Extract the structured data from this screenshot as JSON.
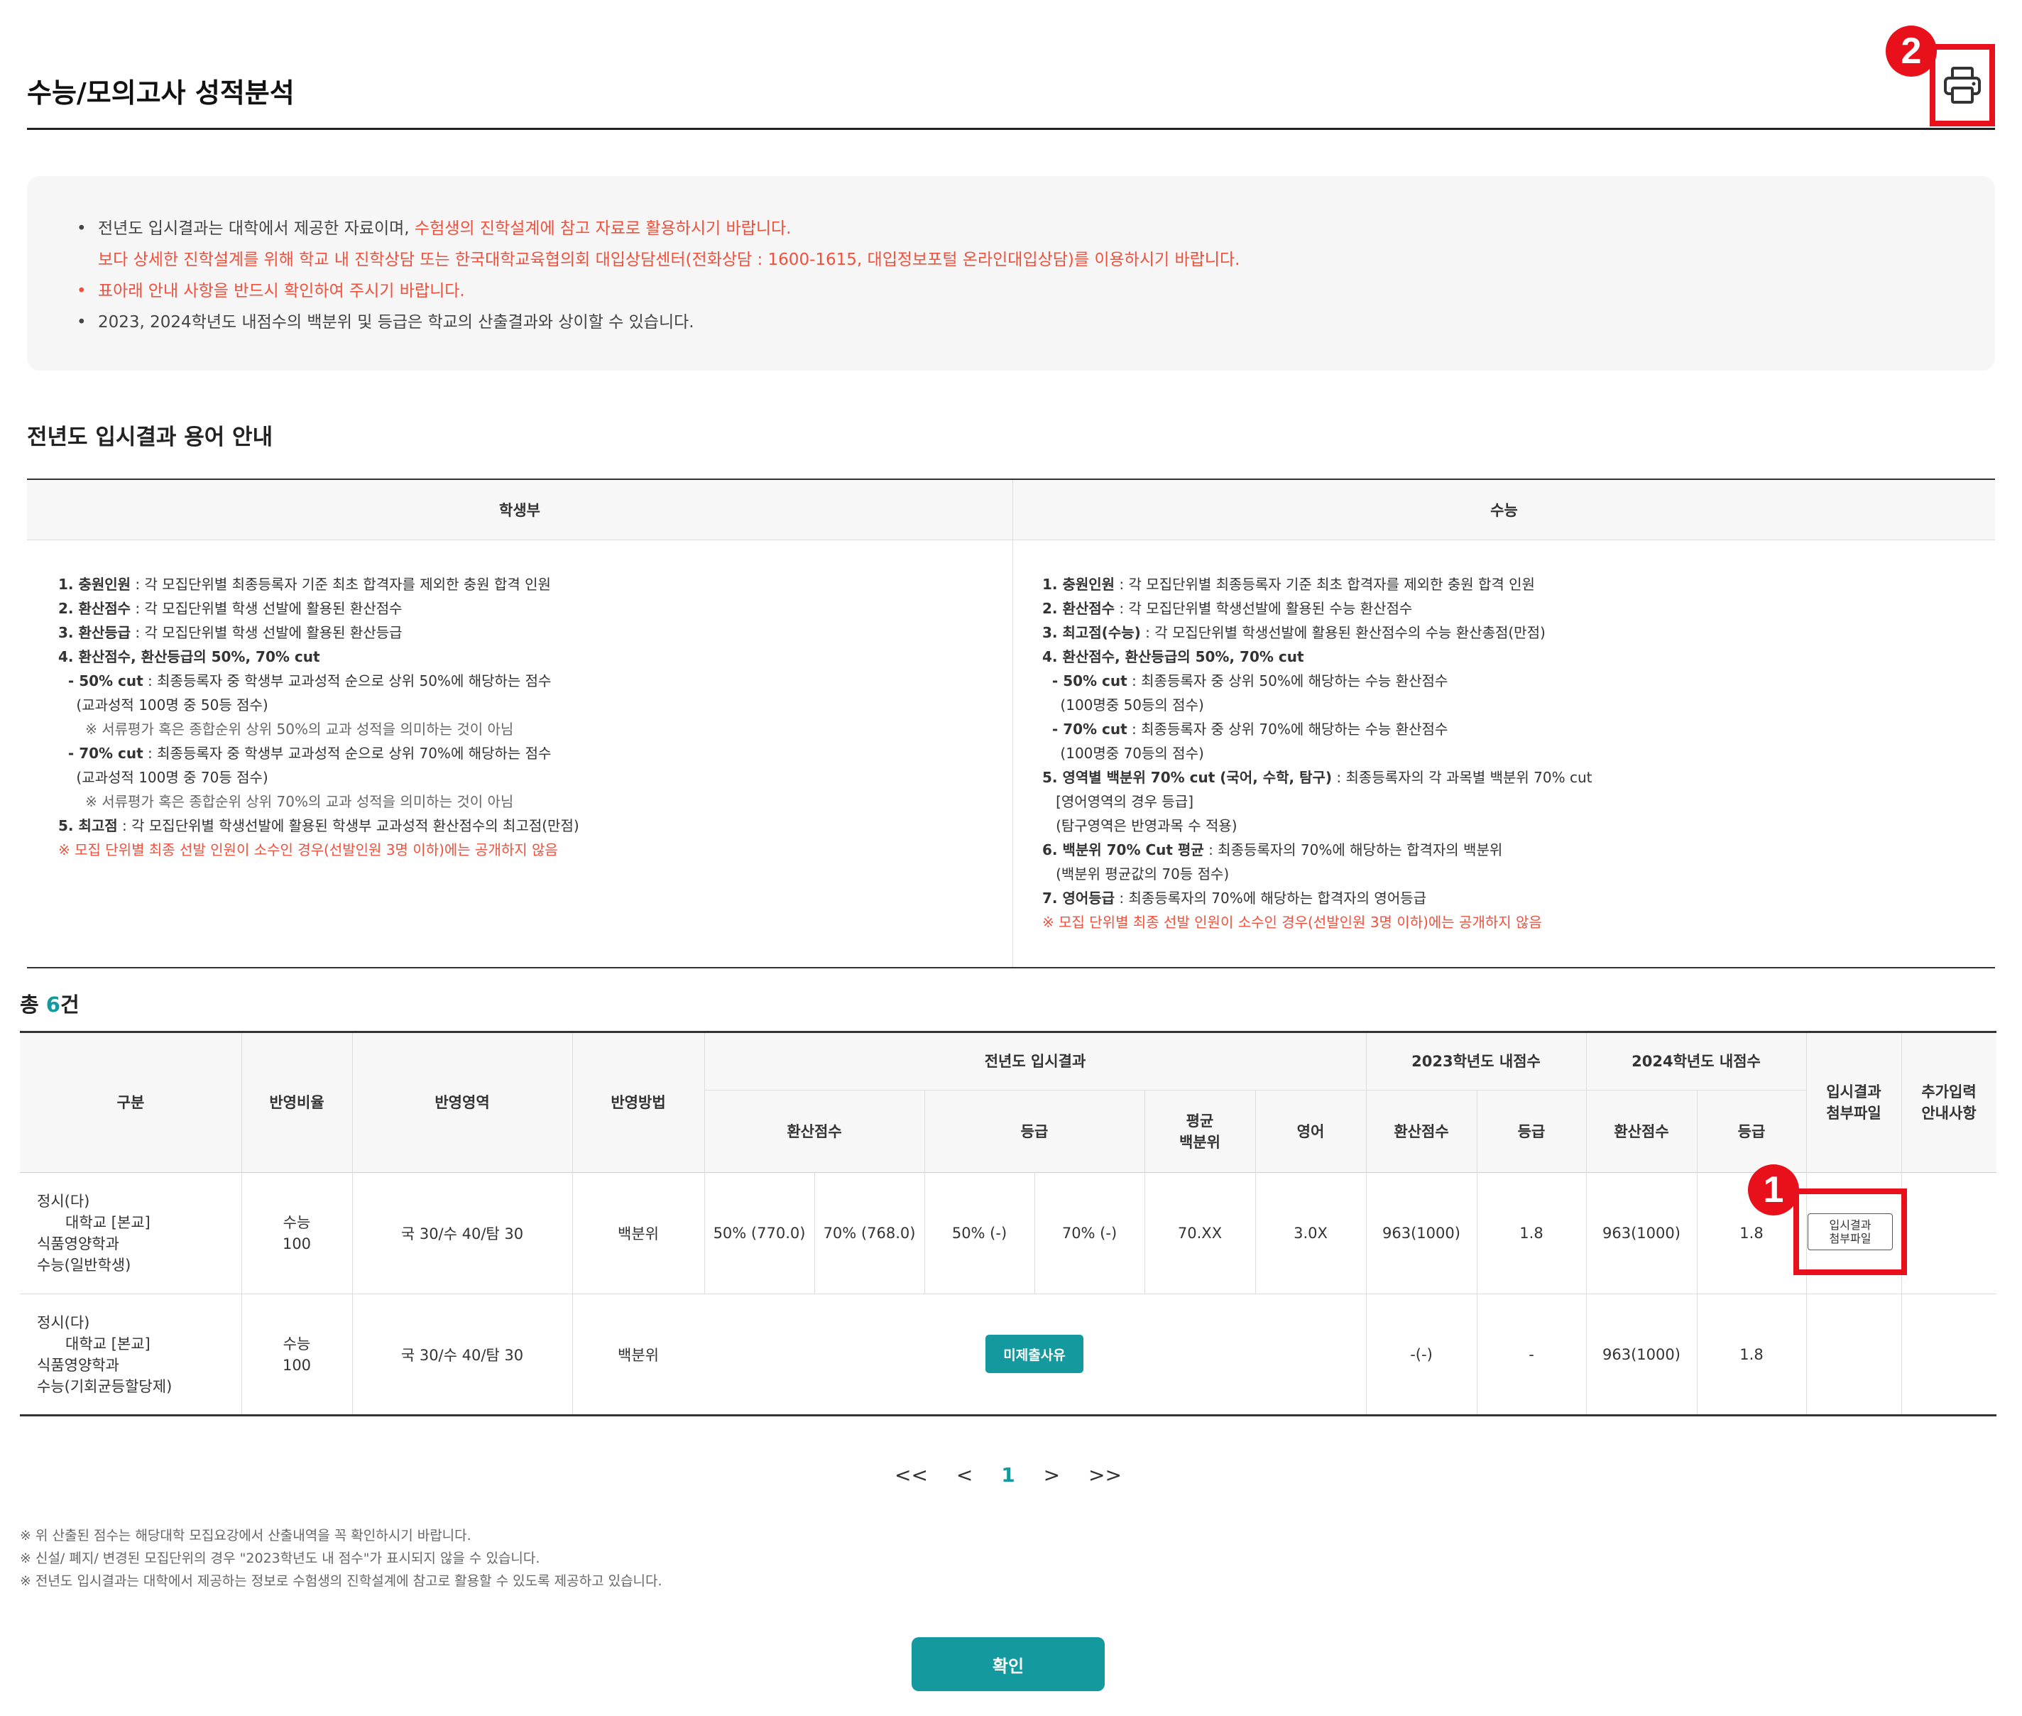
{
  "header": {
    "title": "수능/모의고사 성적분석",
    "print_icon": "printer-icon",
    "callout_2": "2"
  },
  "notice": {
    "line1_a": "전년도 입시결과는 대학에서 제공한 자료이며, ",
    "line1_b": "수험생의 진학설계에 참고 자료로 활용하시기 바랍니다.",
    "line2": "보다 상세한 진학설계를 위해 학교 내 진학상담 또는 한국대학교육협의회 대입상담센터(전화상담 : 1600-1615, 대입정보포털 온라인대입상담)를 이용하시기 바랍니다.",
    "line3": "표아래 안내 사항을 반드시 확인하여 주시기 바랍니다.",
    "line4": "2023, 2024학년도 내점수의 백분위 및 등급은 학교의 산출결과와 상이할 수 있습니다."
  },
  "terms": {
    "heading": "전년도 입시결과 용어 안내",
    "col_student": "학생부",
    "col_suneung": "수능",
    "student_lines": [
      {
        "b": "1. 충원인원",
        "t": " : 각 모집단위별 최종등록자 기준 최초 합격자를 제외한 충원 합격 인원"
      },
      {
        "b": "2. 환산점수",
        "t": " : 각 모집단위별 학생 선발에 활용된 환산점수"
      },
      {
        "b": "3. 환산등급",
        "t": " : 각 모집단위별 학생 선발에 활용된 환산등급"
      },
      {
        "b": "4. 환산점수, 환산등급의 50%, 70% cut",
        "t": ""
      },
      {
        "b": "  - 50% cut",
        "t": " : 최종등록자 중 학생부 교과성적 순으로 상위 50%에 해당하는 점수"
      },
      {
        "b": "",
        "t": "    (교과성적 100명 중 50등 점수)"
      },
      {
        "b": "",
        "t": "      ※ 서류평가 혹은 종합순위 상위 50%의 교과 성적을 의미하는 것이 아님",
        "cls": "note"
      },
      {
        "b": "  - 70% cut",
        "t": " : 최종등록자 중 학생부 교과성적 순으로 상위 70%에 해당하는 점수"
      },
      {
        "b": "",
        "t": "    (교과성적 100명 중 70등 점수)"
      },
      {
        "b": "",
        "t": "      ※ 서류평가 혹은 종합순위 상위 70%의 교과 성적을 의미하는 것이 아님",
        "cls": "note"
      },
      {
        "b": "5. 최고점",
        "t": " : 각 모집단위별 학생선발에 활용된 학생부 교과성적 환산점수의 최고점(만점)"
      },
      {
        "b": "",
        "t": "※ 모집 단위별 최종 선발 인원이 소수인 경우(선발인원 3명 이하)에는 공개하지 않음",
        "cls": "warn"
      }
    ],
    "suneung_lines": [
      {
        "b": "1. 충원인원",
        "t": " : 각 모집단위별 최종등록자 기준 최초 합격자를 제외한 충원 합격 인원"
      },
      {
        "b": "2. 환산점수",
        "t": " : 각 모집단위별 학생선발에 활용된 수능 환산점수"
      },
      {
        "b": "3. 최고점(수능)",
        "t": " : 각 모집단위별 학생선발에 활용된 환산점수의 수능 환산총점(만점)"
      },
      {
        "b": "4. 환산점수, 환산등급의 50%, 70% cut",
        "t": ""
      },
      {
        "b": "  - 50% cut",
        "t": " : 최종등록자 중 상위 50%에 해당하는 수능 환산점수"
      },
      {
        "b": "",
        "t": "    (100명중 50등의 점수)"
      },
      {
        "b": "  - 70% cut",
        "t": " : 최종등록자 중 상위 70%에 해당하는 수능 환산점수"
      },
      {
        "b": "",
        "t": "    (100명중 70등의 점수)"
      },
      {
        "b": "5. 영역별 백분위 70% cut (국어, 수학, 탐구)",
        "t": " : 최종등록자의 각 과목별 백분위 70% cut"
      },
      {
        "b": "",
        "t": "   [영어영역의 경우 등급]"
      },
      {
        "b": "",
        "t": "   (탐구영역은 반영과목 수 적용)"
      },
      {
        "b": "6. 백분위 70% Cut 평균",
        "t": " : 최종등록자의 70%에 해당하는 합격자의 백분위"
      },
      {
        "b": "",
        "t": "   (백분위 평균값의 70등 점수)"
      },
      {
        "b": "7. 영어등급",
        "t": " : 최종등록자의 70%에 해당하는 합격자의 영어등급"
      },
      {
        "b": "",
        "t": "※ 모집 단위별 최종 선발 인원이 소수인 경우(선발인원 3명 이하)에는 공개하지 않음",
        "cls": "warn"
      }
    ]
  },
  "total": {
    "prefix": "총 ",
    "count": "6",
    "suffix": "건"
  },
  "table": {
    "h_category": "구분",
    "h_ratio": "반영비율",
    "h_area": "반영영역",
    "h_method": "반영방법",
    "h_prev": "전년도 입시결과",
    "h_2023": "2023학년도 내점수",
    "h_2024": "2024학년도 내점수",
    "h_attach": "입시결과\n첨부파일",
    "h_extra": "추가입력\n안내사항",
    "h_score": "환산점수",
    "h_grade": "등급",
    "h_avg": "평균\n백분위",
    "h_eng": "영어",
    "h_2023_score": "환산점수",
    "h_2023_grade": "등급",
    "h_2024_score": "환산점수",
    "h_2024_grade": "등급",
    "rows": [
      {
        "category": "정시(다)\n      대학교 [본교]\n식품영양학과\n수능(일반학생)",
        "ratio": "수능\n100",
        "area": "국 30/수 40/탐 30",
        "method": "백분위",
        "score50": "50% (770.0)",
        "score70": "70% (768.0)",
        "grade50": "50% (-)",
        "grade70": "70% (-)",
        "avg": "70.XX",
        "eng": "3.0X",
        "s2023": "963(1000)",
        "g2023": "1.8",
        "s2024": "963(1000)",
        "g2024": "1.8",
        "attach_label": "입시결과\n첨부파일"
      },
      {
        "category": "정시(다)\n      대학교 [본교]\n식품영양학과\n수능(기회균등할당제)",
        "ratio": "수능\n100",
        "area": "국 30/수 40/탐 30",
        "method": "백분위",
        "not_submitted": "미제출사유",
        "s2023": "-(-)",
        "g2023": "-",
        "s2024": "963(1000)",
        "g2024": "1.8"
      }
    ],
    "callout_1": "1"
  },
  "pagination": {
    "first": "<<",
    "prev": "<",
    "current": "1",
    "next": ">",
    "last": ">>"
  },
  "footnotes": [
    "※ 위 산출된 점수는 해당대학 모집요강에서 산출내역을 꼭 확인하시기 바랍니다.",
    "※ 신설/ 폐지/ 변경된 모집단위의 경우 \"2023학년도 내 점수\"가 표시되지 않을 수 있습니다.",
    "※ 전년도 입시결과는 대학에서 제공하는 정보로 수험생의 진학설계에 참고로 활용할 수 있도록 제공하고 있습니다."
  ],
  "confirm_label": "확인",
  "colors": {
    "accent": "#13999e",
    "warn": "#f0503c",
    "callout": "#e8101a"
  }
}
